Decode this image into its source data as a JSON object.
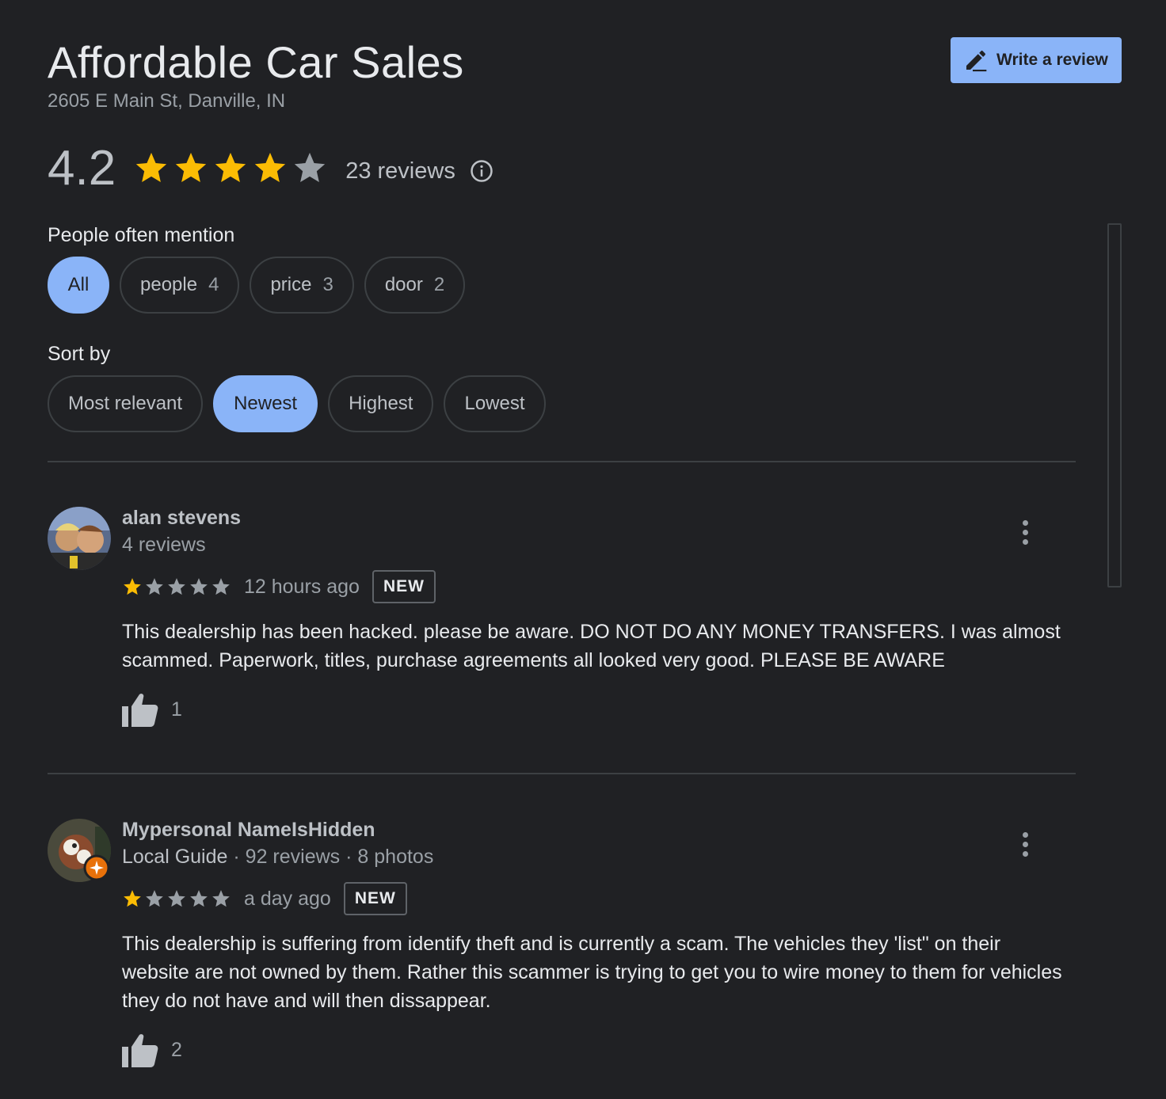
{
  "business": {
    "name": "Affordable Car Sales",
    "address": "2605 E Main St, Danville, IN",
    "rating": "4.2",
    "reviews_count": "23 reviews"
  },
  "write_review": {
    "label": "Write a review"
  },
  "mentions": {
    "label": "People often mention",
    "chips": [
      {
        "label": "All",
        "count": ""
      },
      {
        "label": "people",
        "count": "4"
      },
      {
        "label": "price",
        "count": "3"
      },
      {
        "label": "door",
        "count": "2"
      }
    ]
  },
  "sort": {
    "label": "Sort by",
    "options": [
      "Most relevant",
      "Newest",
      "Highest",
      "Lowest"
    ],
    "selected": "Newest"
  },
  "reviews": [
    {
      "name": "alan stevens",
      "meta": "4 reviews",
      "stars": 1,
      "time": "12 hours ago",
      "badge": "NEW",
      "text": "This dealership has been hacked. please be aware. DO NOT DO ANY MONEY TRANSFERS. I was almost scammed. Paperwork, titles, purchase agreements all looked very good. PLEASE BE AWARE",
      "likes": "1"
    },
    {
      "name": "Mypersonal NameIsHidden",
      "guide": "Local Guide",
      "meta_reviews": "92 reviews",
      "meta_photos": "8 photos",
      "separator": "·",
      "stars": 1,
      "time": "a day ago",
      "badge": "NEW",
      "text": "This dealership is suffering from identify theft and is currently a scam.  The vehicles they 'list\" on their website are not owned by them.   Rather this scammer is trying to get you to wire money to them for vehicles they do not have and will then dissappear.",
      "likes": "2"
    }
  ],
  "colors": {
    "background": "#202124",
    "accent": "#8ab4f8",
    "star_filled": "#fbbc04",
    "star_empty": "#9aa0a6"
  }
}
